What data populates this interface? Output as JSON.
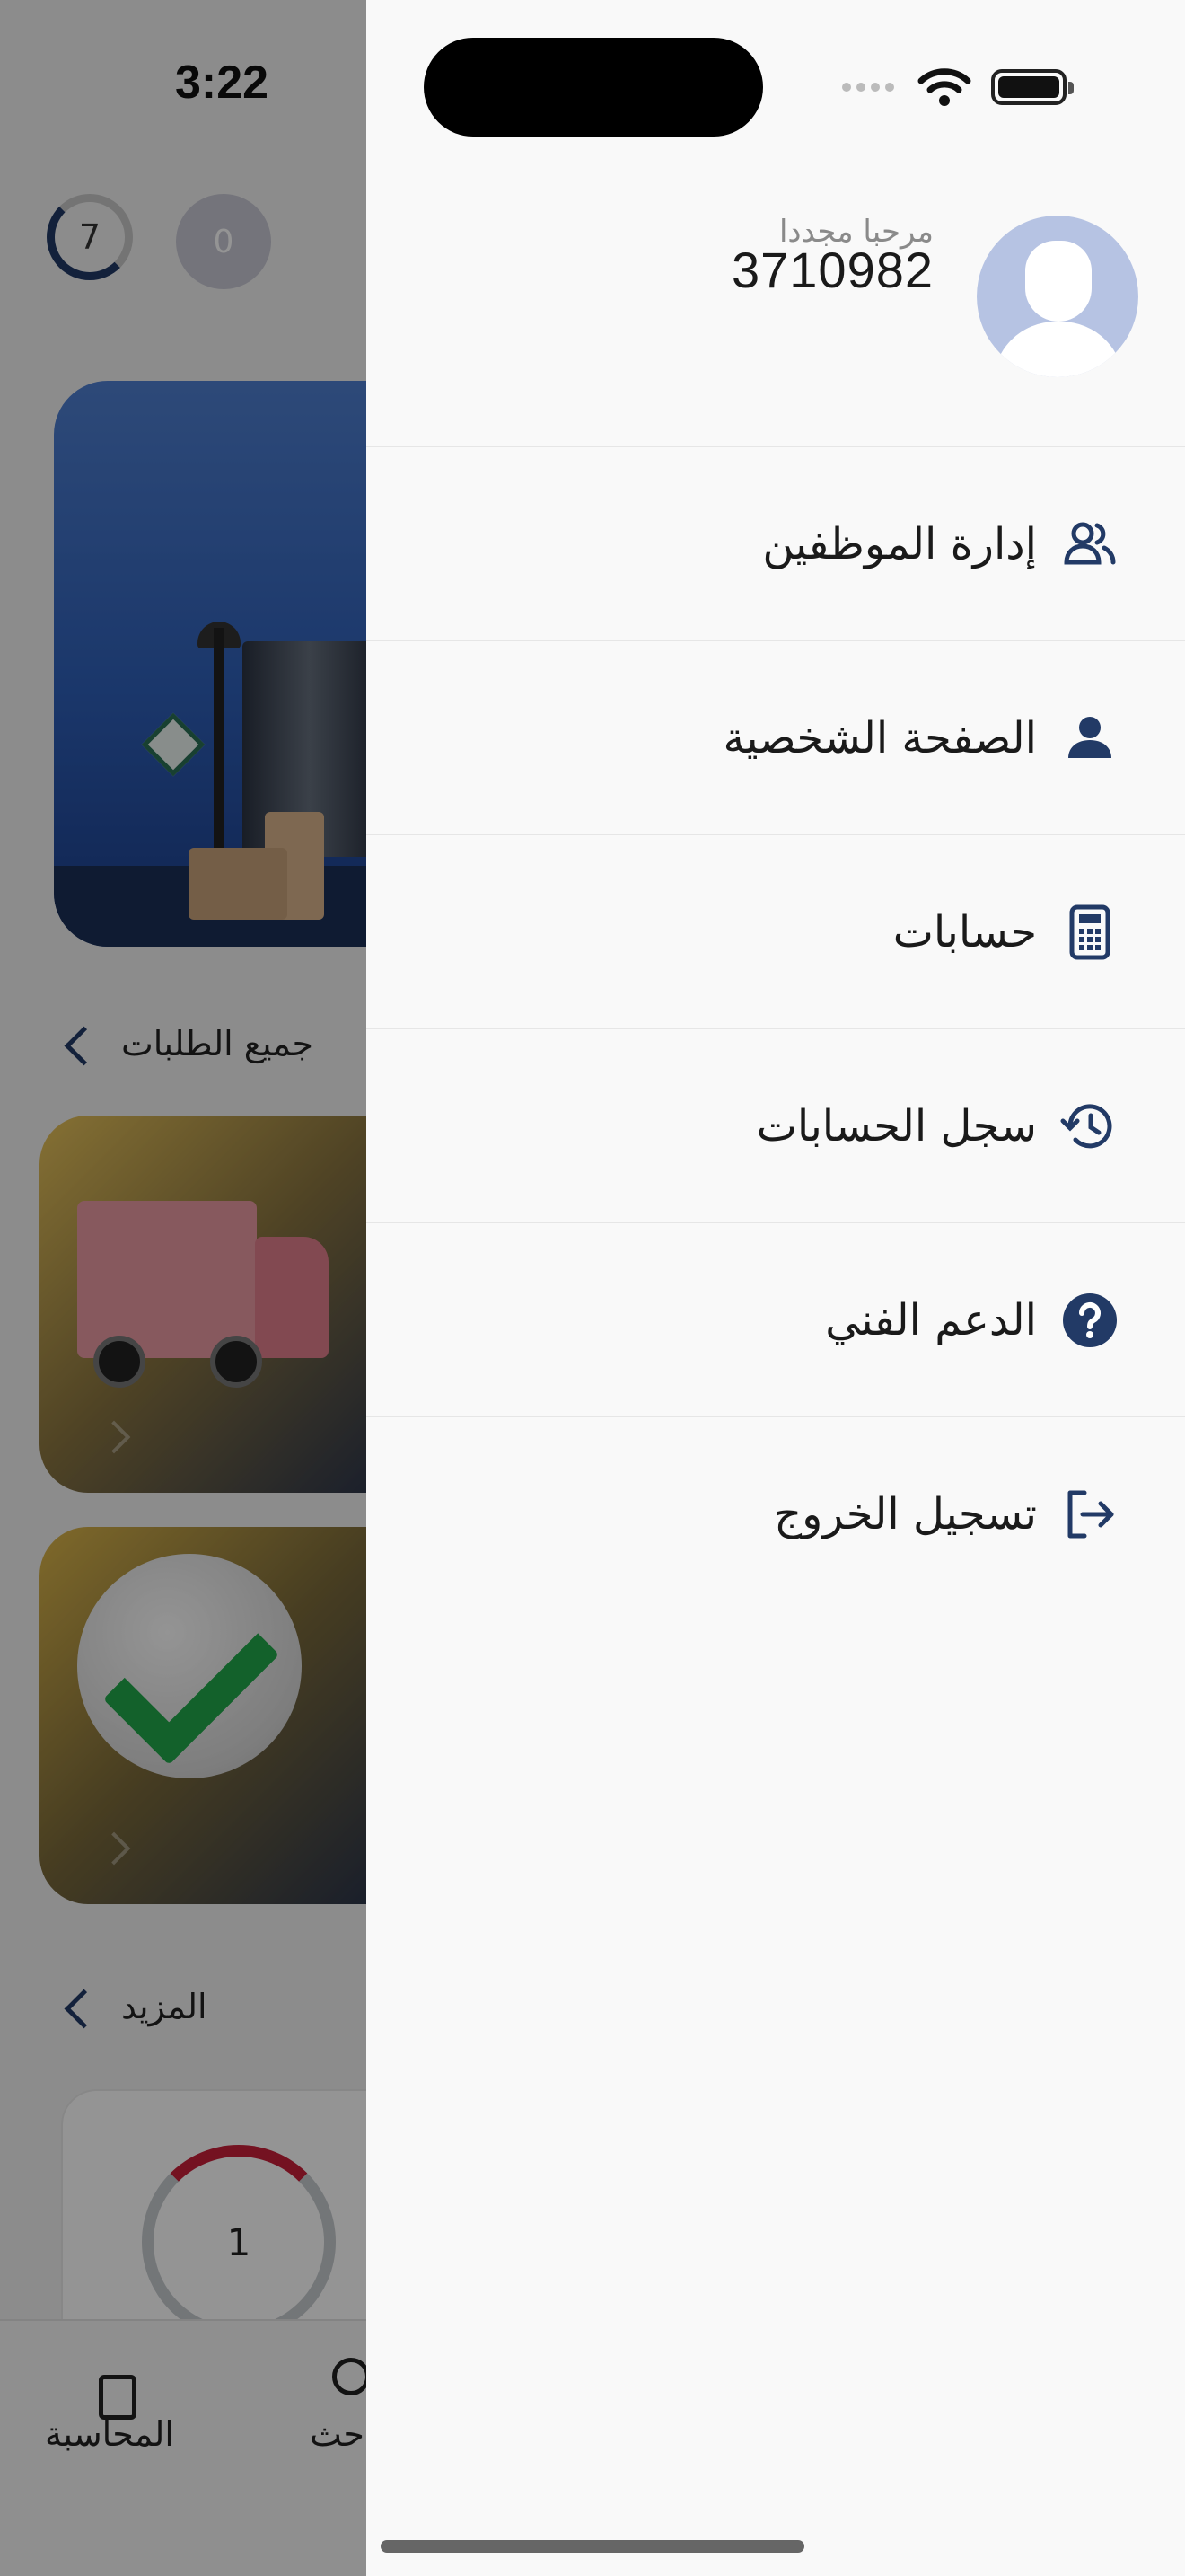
{
  "status_bar": {
    "time": "3:22"
  },
  "background": {
    "counters": {
      "ring_value": "7",
      "circle_value": "0"
    },
    "sections": {
      "all_orders": "جميع الطلبات",
      "more": "المزيد"
    },
    "stat_card": {
      "value": "1"
    },
    "bottom_nav": {
      "accounting_label": "المحاسبة",
      "search_label_partial": "حث"
    }
  },
  "drawer": {
    "profile": {
      "welcome": "مرحبا مجددا",
      "user_id": "3710982"
    },
    "menu": [
      {
        "label": "إدارة الموظفين",
        "icon": "users-icon"
      },
      {
        "label": "الصفحة الشخصية",
        "icon": "user-icon"
      },
      {
        "label": "حسابات",
        "icon": "calculator-icon"
      },
      {
        "label": "سجل الحسابات",
        "icon": "history-icon"
      },
      {
        "label": "الدعم الفني",
        "icon": "help-circle-icon"
      },
      {
        "label": "تسجيل الخروج",
        "icon": "logout-icon"
      }
    ]
  },
  "colors": {
    "primary": "#223A66",
    "avatar_bg": "#B6C3E3",
    "accent_red": "#C8203A"
  }
}
